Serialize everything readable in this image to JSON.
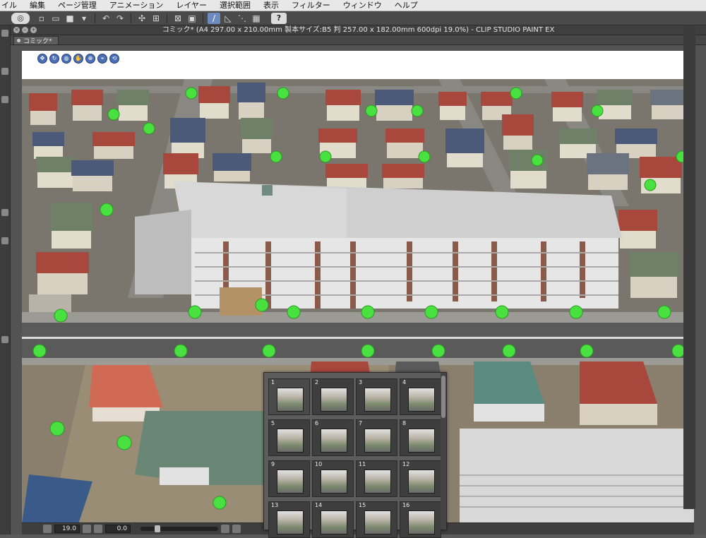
{
  "menubar": {
    "items": [
      "イル",
      "編集",
      "ページ管理",
      "アニメーション",
      "レイヤー",
      "選択範囲",
      "表示",
      "フィルター",
      "ウィンドウ",
      "ヘルプ"
    ]
  },
  "window": {
    "title": "コミック* (A4 297.00 x 210.00mm 製本サイズ:B5 判 257.00 x 182.00mm 600dpi 19.0%)  - CLIP STUDIO PAINT EX",
    "tab_label": "コミック*"
  },
  "toolbar": {
    "icons": [
      "app-logo-icon",
      "new-file-icon",
      "open-file-icon",
      "save-icon",
      "save-menu-icon",
      "undo-icon",
      "redo-icon",
      "transform-icon",
      "snap-icon",
      "erase-icon",
      "fill-icon",
      "ruler-snap-icon",
      "perspective-ruler-icon",
      "special-ruler-icon",
      "grid-icon",
      "help-icon"
    ],
    "help_label": "?"
  },
  "statusbar": {
    "zoom": "19.0",
    "angle": "0.0"
  },
  "pages_panel": {
    "pages": [
      "1",
      "2",
      "3",
      "4",
      "5",
      "6",
      "7",
      "8",
      "9",
      "10",
      "11",
      "12",
      "13",
      "14",
      "15",
      "16"
    ]
  },
  "colors": {
    "accent": "#4b6fb5",
    "tree_green": "#49e13f",
    "roof_red": "#a8483d"
  }
}
